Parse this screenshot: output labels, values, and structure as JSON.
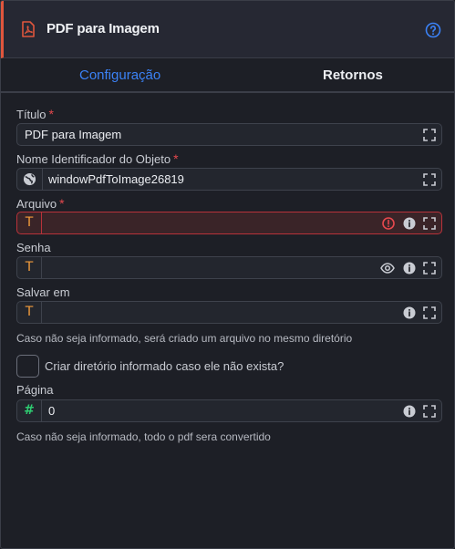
{
  "header": {
    "title": "PDF para Imagem"
  },
  "tabs": [
    {
      "label": "Configuração",
      "active": true
    },
    {
      "label": "Retornos",
      "active": false
    }
  ],
  "fields": {
    "titulo": {
      "label": "Título",
      "required": "*",
      "value": "PDF para Imagem"
    },
    "nome": {
      "label": "Nome Identificador do Objeto",
      "required": "*",
      "value": "windowPdfToImage26819"
    },
    "arquivo": {
      "label": "Arquivo",
      "required": "*",
      "type": "T",
      "value": ""
    },
    "senha": {
      "label": "Senha",
      "type": "T",
      "value": ""
    },
    "salvar": {
      "label": "Salvar em",
      "type": "T",
      "value": "",
      "hint": "Caso não seja informado, será criado um arquivo no mesmo diretório"
    },
    "criar_dir": {
      "label": "Criar diretório informado caso ele não exista?",
      "checked": false
    },
    "pagina": {
      "label": "Página",
      "type": "#",
      "value": "0",
      "hint": "Caso não seja informado, todo o pdf sera convertido"
    }
  },
  "colors": {
    "accent": "#3b82f6",
    "header_bar": "#e0563d",
    "required": "#e5484d",
    "error_border": "#b8323a",
    "type_text": "#f39c3c",
    "type_number": "#2ecc71"
  }
}
